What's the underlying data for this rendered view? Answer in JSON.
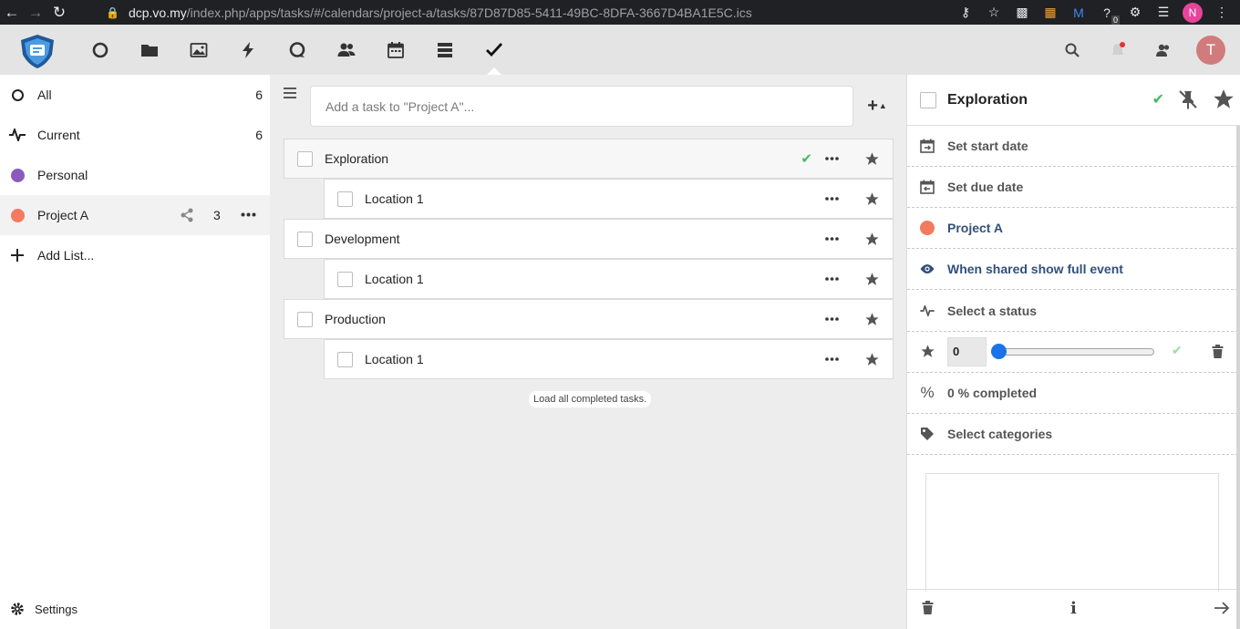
{
  "browser": {
    "url_host": "dcp.vo.my",
    "url_path": "/index.php/apps/tasks/#/calendars/project-a/tasks/87D87D85-5411-49BC-8DFA-3667D4BA1E5C.ics",
    "profile_initial": "N",
    "extension_badge": "0"
  },
  "header": {
    "avatar_initial": "T",
    "nav_icons": [
      "dashboard-icon",
      "files-icon",
      "photos-icon",
      "activity-icon",
      "talk-icon",
      "contacts-icon",
      "calendar-icon",
      "deck-icon",
      "tasks-icon"
    ]
  },
  "sidebar": {
    "items": [
      {
        "label": "All",
        "count": "6"
      },
      {
        "label": "Current",
        "count": "6"
      },
      {
        "label": "Personal",
        "count": "",
        "color": "#8a5bbf"
      },
      {
        "label": "Project A",
        "count": "3",
        "color": "#f27a5f"
      },
      {
        "label": "Add List...",
        "count": ""
      }
    ],
    "settings_label": "Settings"
  },
  "main": {
    "add_placeholder": "Add a task to \"Project A\"...",
    "tasks": [
      {
        "title": "Exploration",
        "level": 0,
        "completed_mark": true
      },
      {
        "title": "Location 1",
        "level": 1
      },
      {
        "title": "Development",
        "level": 0
      },
      {
        "title": "Location 1",
        "level": 1
      },
      {
        "title": "Production",
        "level": 0
      },
      {
        "title": "Location 1",
        "level": 1
      }
    ],
    "load_completed_label": "Load all completed tasks."
  },
  "details": {
    "title": "Exploration",
    "start_date_label": "Set start date",
    "due_date_label": "Set due date",
    "calendar_label": "Project A",
    "calendar_color": "#f27a5f",
    "visibility_label": "When shared show full event",
    "status_label": "Select a status",
    "priority_value": "0",
    "percent_label": "0 % completed",
    "categories_label": "Select categories"
  },
  "colors": {
    "accent_blue": "#1a73e8",
    "check_green": "#46ba61"
  }
}
